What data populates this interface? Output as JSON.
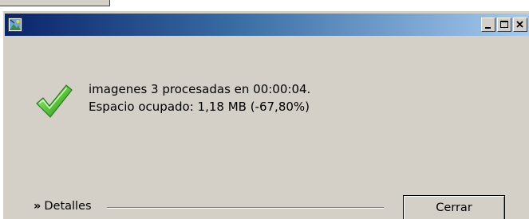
{
  "window": {
    "title": "",
    "icons": {
      "app": "app-image-icon",
      "minimize": "minimize-icon",
      "maximize": "maximize-icon",
      "close": "close-icon"
    }
  },
  "message": {
    "icon": "checkmark-icon",
    "line1": "imagenes 3  procesadas en 00:00:04.",
    "line2": "Espacio ocupado: 1,18 MB (-67,80%)"
  },
  "footer": {
    "details_label": "Detalles",
    "details_chevron": "»",
    "close_label": "Cerrar"
  },
  "colors": {
    "titlebar_start": "#0a246a",
    "titlebar_end": "#a6caf0",
    "window_bg": "#d4d0c8",
    "check_green": "#3cb832"
  }
}
